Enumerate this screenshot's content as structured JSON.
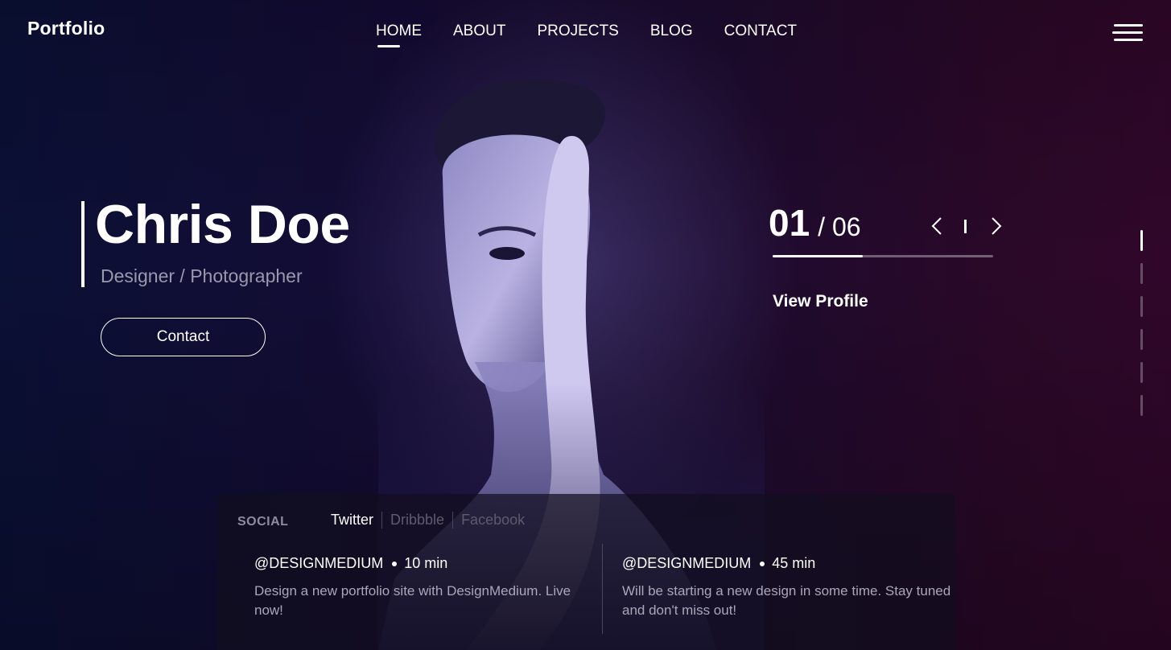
{
  "header": {
    "logo": "Portfolio",
    "nav": [
      {
        "label": "HOME",
        "active": true
      },
      {
        "label": "ABOUT",
        "active": false
      },
      {
        "label": "PROJECTS",
        "active": false
      },
      {
        "label": "BLOG",
        "active": false
      },
      {
        "label": "CONTACT",
        "active": false
      }
    ],
    "menu_icon": "hamburger-menu-icon"
  },
  "hero": {
    "name": "Chris Doe",
    "role": "Designer / Photographer",
    "contact_label": "Contact"
  },
  "slider": {
    "current": "01",
    "total": "/ 06",
    "progress": 0.41,
    "view_profile_label": "View Profile",
    "prev_icon": "chevron-left-icon",
    "next_icon": "chevron-right-icon",
    "pages": 6,
    "active_page": 1
  },
  "social": {
    "label": "SOCIAL",
    "tabs": [
      {
        "label": "Twitter",
        "active": true
      },
      {
        "label": "Dribbble",
        "active": false
      },
      {
        "label": "Facebook",
        "active": false
      }
    ],
    "posts": [
      {
        "handle": "@DESIGNMEDIUM",
        "time": "10 min",
        "text": "Design a new portfolio site with DesignMedium. Live now!"
      },
      {
        "handle": "@DESIGNMEDIUM",
        "time": "45 min",
        "text": "Will be starting a new design in some time. Stay tuned and don't miss out!"
      }
    ]
  },
  "colors": {
    "background_left": "#0b1036",
    "background_right": "#30072a",
    "muted_text": "#9a98ad",
    "accent": "#ffffff"
  }
}
